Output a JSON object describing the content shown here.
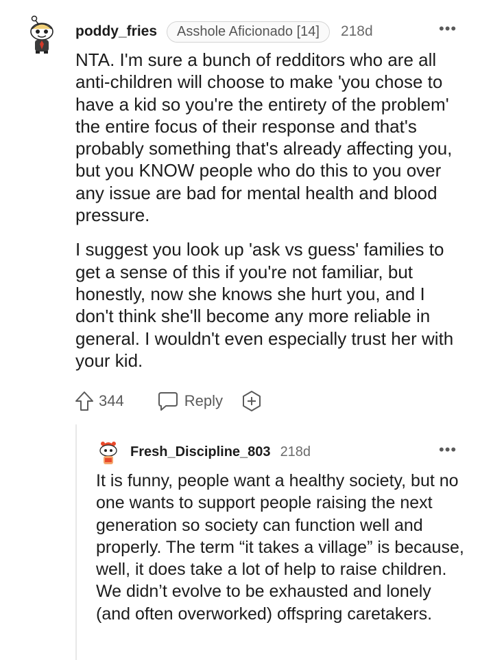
{
  "comment": {
    "username": "poddy_fries",
    "flair": "Asshole Aficionado [14]",
    "age": "218d",
    "more": "•••",
    "paragraphs": [
      "NTA. I'm sure a bunch of redditors who are all anti-children will choose to make 'you chose to have a kid so you're the entirety of the problem' the entire focus of their response and that's probably something that's already affecting you, but you KNOW people who do this to you over any issue are bad for mental health and blood pressure.",
      "I suggest you look up 'ask vs guess' families to get a sense of this if you're not familiar, but honestly, now she knows she hurt you, and I don't think she'll become any more reliable in general. I wouldn't even especially trust her with your kid."
    ],
    "score": "344",
    "reply_label": "Reply"
  },
  "reply": {
    "username": "Fresh_Discipline_803",
    "age": "218d",
    "more": "•••",
    "text": "It is funny, people want a healthy society, but no one wants to support people raising the next generation so society can function well and properly. The term “it takes a village” is because, well, it does take a lot of help to raise children. We didn’t evolve to be exhausted and lonely (and often overworked) offspring caretakers."
  },
  "colors": {
    "text": "#1c1c1c",
    "meta": "#6a6a6a",
    "icon": "#5a5a5a",
    "avatar_accent": "#e8492b"
  },
  "icons": [
    "snoo-avatar-icon",
    "upvote-arrow-icon",
    "reply-bubble-icon",
    "award-plus-icon",
    "snoo-avatar-orange-icon"
  ]
}
